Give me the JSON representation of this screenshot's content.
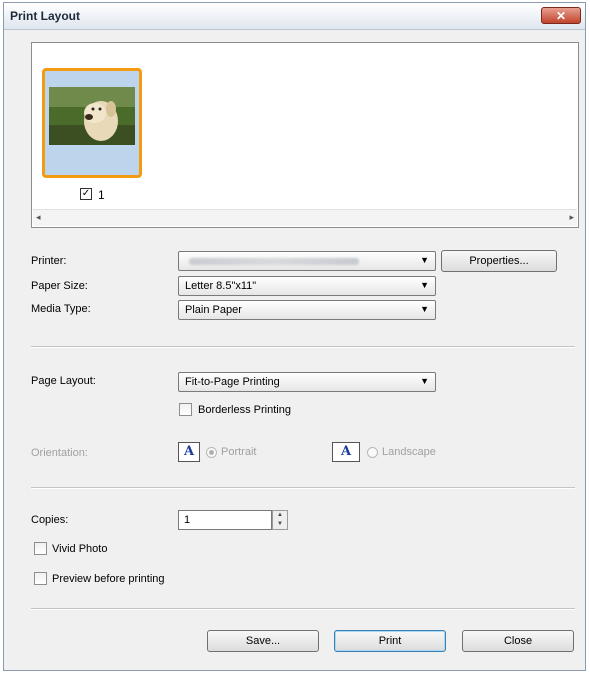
{
  "window": {
    "title": "Print Layout",
    "close_label": "✕"
  },
  "preview": {
    "thumbnail": {
      "checked": true,
      "label": "1"
    },
    "scroll_left": "◂",
    "scroll_right": "▸"
  },
  "printer": {
    "label": "Printer:",
    "value": "",
    "properties_label": "Properties..."
  },
  "paper_size": {
    "label": "Paper Size:",
    "value": "Letter 8.5\"x11\""
  },
  "media_type": {
    "label": "Media Type:",
    "value": "Plain Paper"
  },
  "page_layout": {
    "label": "Page Layout:",
    "value": "Fit-to-Page Printing"
  },
  "borderless": {
    "label": "Borderless Printing",
    "checked": false
  },
  "orientation": {
    "label": "Orientation:",
    "portrait_icon": "A",
    "portrait_label": "Portrait",
    "landscape_icon": "A",
    "landscape_label": "Landscape",
    "selected": "Portrait"
  },
  "copies": {
    "label": "Copies:",
    "value": "1"
  },
  "vivid_photo": {
    "label": "Vivid Photo",
    "checked": false
  },
  "preview_before_printing": {
    "label": "Preview before printing",
    "checked": false
  },
  "buttons": {
    "save": "Save...",
    "print": "Print",
    "close": "Close"
  },
  "icons": {
    "dropdown_arrow": "▼",
    "check": "✓",
    "spin_up": "▲",
    "spin_down": "▼"
  }
}
